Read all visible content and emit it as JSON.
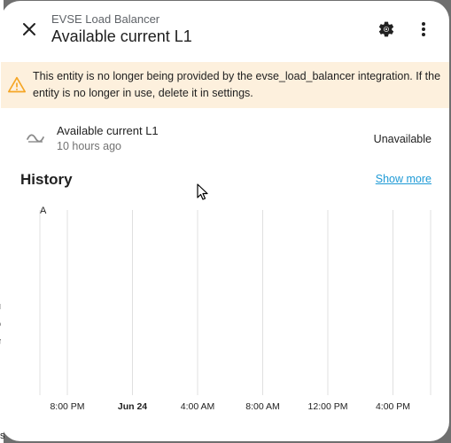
{
  "dialog": {
    "subtitle": "EVSE Load Balancer",
    "title": "Available current L1",
    "close_icon": "close-icon",
    "settings_icon": "gear-icon",
    "more_icon": "more-vertical-icon"
  },
  "warning": {
    "icon": "alert-triangle-icon",
    "text": "This entity is no longer being provided by the evse_load_balancer integration. If the entity is no longer in use, delete it in settings.",
    "color": "#fdf0dd",
    "icon_color": "#f5a524"
  },
  "entity": {
    "icon": "sine-wave-icon",
    "name": "Available current L1",
    "last_changed": "10 hours ago",
    "state": "Unavailable"
  },
  "history": {
    "title": "History",
    "show_more_label": "Show more",
    "link_color": "#1e9ad6"
  },
  "chart_data": {
    "type": "line",
    "ylabel": "A",
    "categories": [
      "8:00 PM",
      "Jun 24",
      "4:00 AM",
      "8:00 AM",
      "12:00 PM",
      "4:00 PM"
    ],
    "bold_categories": [
      "Jun 24"
    ],
    "series": [],
    "grid": true
  },
  "background": {
    "edge_letters": [
      "r",
      "e",
      "t",
      "s"
    ]
  }
}
